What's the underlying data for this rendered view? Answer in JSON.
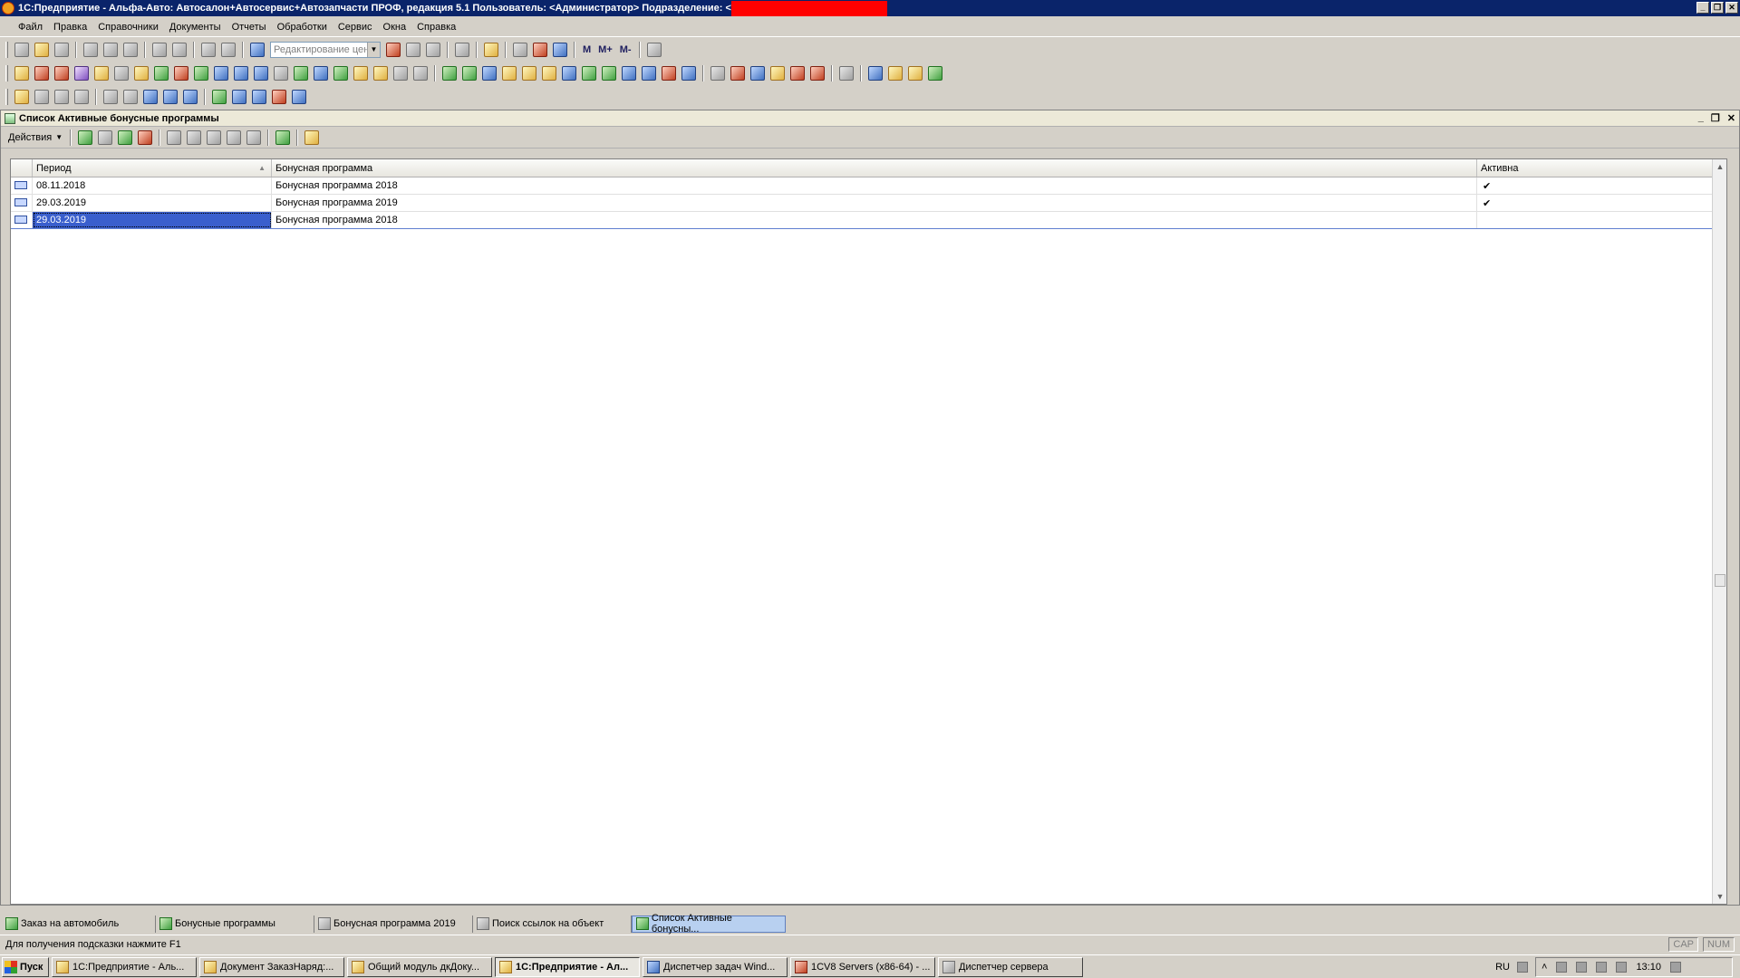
{
  "window": {
    "title": "1С:Предприятие - Альфа-Авто: Автосалон+Автосервис+Автозапчасти ПРОФ, редакция 5.1    Пользователь: <Администратор>    Подразделение: <",
    "minimize": "_",
    "restore": "❐",
    "close": "✕"
  },
  "menu": [
    "Файл",
    "Правка",
    "Справочники",
    "Документы",
    "Отчеты",
    "Обработки",
    "Сервис",
    "Окна",
    "Справка"
  ],
  "toolbar": {
    "search_placeholder": "Редактирование цен и",
    "m_label": "M",
    "mplus_label": "M+",
    "mminus_label": "M-"
  },
  "child_window": {
    "title": "Список Активные бонусные программы",
    "actions_label": "Действия"
  },
  "table": {
    "columns": [
      "Период",
      "Бонусная программа",
      "Активна"
    ],
    "rows": [
      {
        "period": "08.11.2018",
        "program": "Бонусная программа 2018",
        "active": "✔"
      },
      {
        "period": "29.03.2019",
        "program": "Бонусная программа 2019",
        "active": "✔"
      },
      {
        "period": "29.03.2019",
        "program": "Бонусная программа 2018",
        "active": ""
      }
    ]
  },
  "window_tabs": [
    "Заказ на автомобиль",
    "Бонусные программы",
    "Бонусная программа 2019",
    "Поиск ссылок на объект",
    "Список Активные бонусны..."
  ],
  "status": {
    "hint": "Для получения подсказки нажмите F1",
    "cap": "CAP",
    "num": "NUM"
  },
  "taskbar": {
    "start": "Пуск",
    "tasks": [
      "1С:Предприятие - Аль...",
      "Документ ЗаказНаряд:...",
      "Общий модуль дкДоку...",
      "1С:Предприятие - Ал...",
      "Диспетчер задач Wind...",
      "1CV8 Servers (x86-64) - ...",
      "Диспетчер сервера"
    ],
    "lang": "RU",
    "time": "13:10"
  },
  "colors": {
    "title_bg": "#0a246a",
    "selection": "#3a5fcd",
    "redaction": "#ff0000"
  }
}
